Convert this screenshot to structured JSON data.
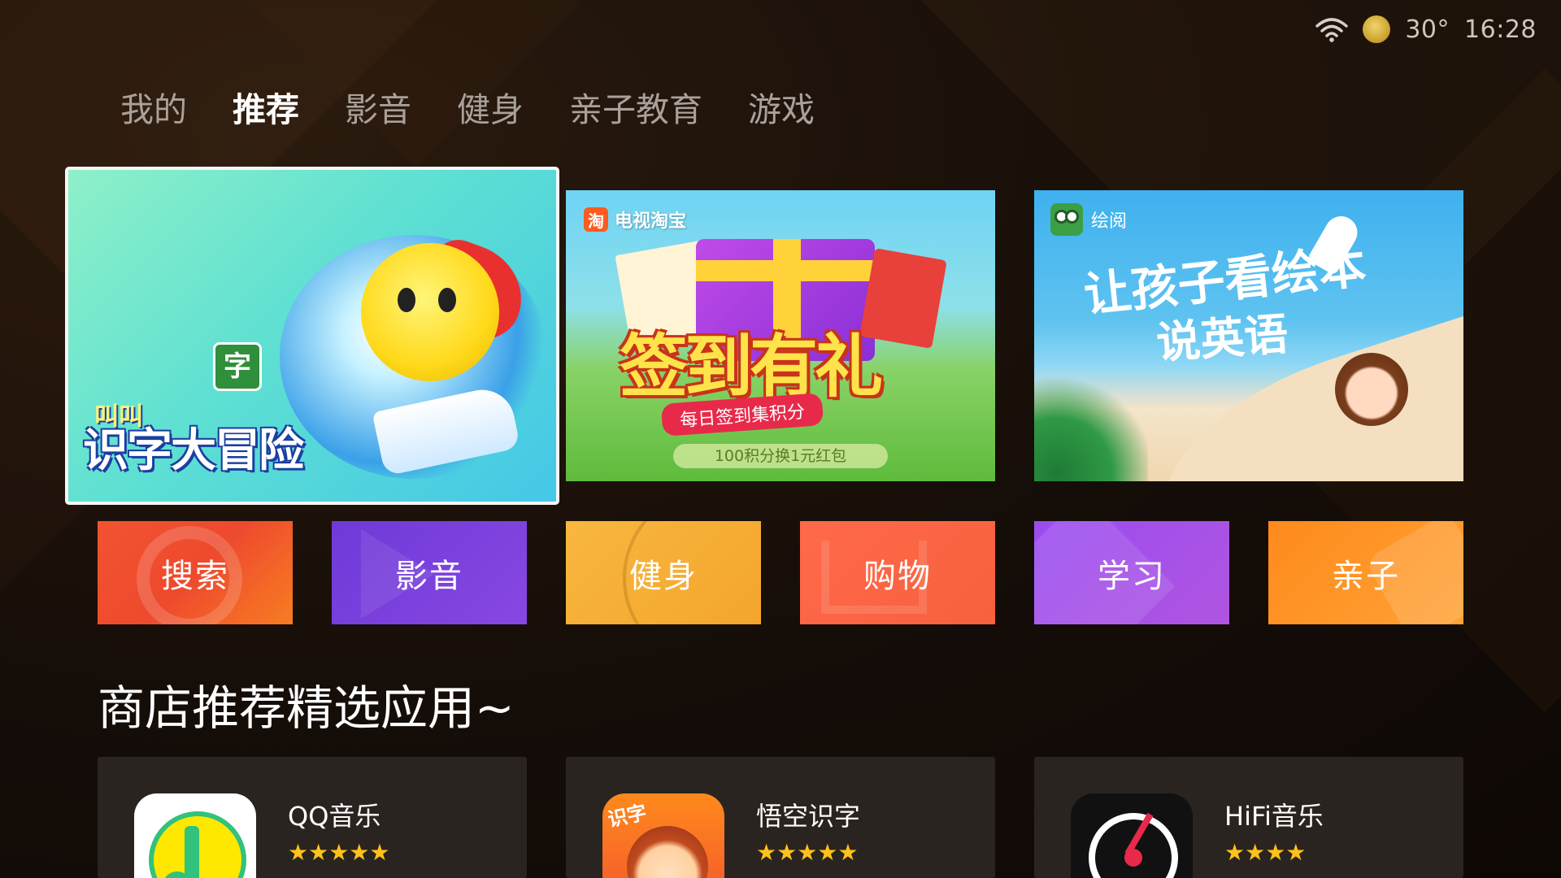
{
  "status": {
    "wifi_icon": "wifi-icon",
    "weather_icon": "weather-icon",
    "temperature": "30°",
    "time": "16:28"
  },
  "nav": {
    "tabs": [
      {
        "label": "我的",
        "active": false
      },
      {
        "label": "推荐",
        "active": true
      },
      {
        "label": "影音",
        "active": false
      },
      {
        "label": "健身",
        "active": false
      },
      {
        "label": "亲子教育",
        "active": false
      },
      {
        "label": "游戏",
        "active": false
      }
    ]
  },
  "banners": [
    {
      "kicker": "叫叫",
      "title": "识字大冒险",
      "badge": "字",
      "focused": true
    },
    {
      "brand": "电视淘宝",
      "brand_logo_text": "淘",
      "headline": "签到有礼",
      "subtitle": "每日签到集积分",
      "footnote": "100积分换1元红包"
    },
    {
      "brand": "绘阅",
      "line1": "让孩子看绘本",
      "line2": "说英语"
    }
  ],
  "categories": [
    {
      "label": "搜索",
      "color": "#f25330"
    },
    {
      "label": "影音",
      "color": "#7a40dc"
    },
    {
      "label": "健身",
      "color": "#f6ae36"
    },
    {
      "label": "购物",
      "color": "#fb6645"
    },
    {
      "label": "学习",
      "color": "#a44fe8"
    },
    {
      "label": "亲子",
      "color": "#ff951f"
    }
  ],
  "section": {
    "title": "商店推荐精选应用~"
  },
  "apps": [
    {
      "name": "QQ音乐",
      "rating": 5,
      "stars": "★★★★★",
      "icon": "qq-music-icon"
    },
    {
      "name": "悟空识字",
      "rating": 5,
      "stars": "★★★★★",
      "icon": "wukong-icon",
      "icon_tag": "识字"
    },
    {
      "name": "HiFi音乐",
      "rating": 4,
      "stars": "★★★★",
      "icon": "hifi-music-icon"
    }
  ]
}
